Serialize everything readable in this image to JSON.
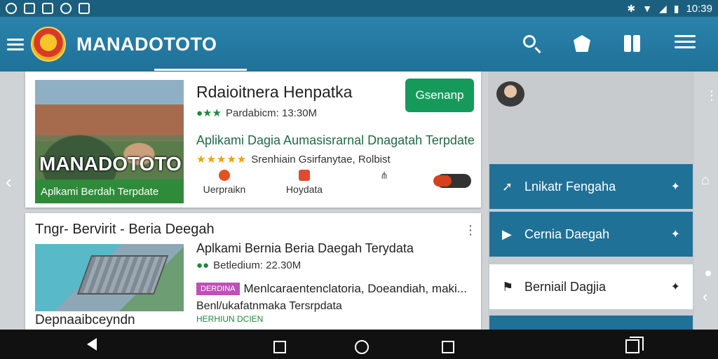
{
  "status_bar": {
    "time": "10:39"
  },
  "app_bar": {
    "title": "MANADOTOTO"
  },
  "card1": {
    "title": "Rdaioitnera Henpatka",
    "install_label": "Gsenanp",
    "meta": "Pardabicm: 13:30M",
    "subtitle": "Aplikami Dagia Aumasisrarnal Dnagatah Terpdate",
    "rating_text": "Srenhiain Gsirfanytae, Rolbist",
    "thumb_overlay_title": "MANADOTOTO",
    "thumb_overlay_caption": "Aplkami Berdah Terpdate",
    "actions": [
      {
        "label": "Uerpraikn"
      },
      {
        "label": "Hoydata"
      },
      {
        "label": ""
      }
    ]
  },
  "card2": {
    "title": "Tngr- Bervirit - Beria Deegah",
    "subtitle": "Aplkami Bernia Beria Daegah Terydata",
    "meta": "Betledium: 22.30M",
    "tag": "DERDINA",
    "tagline": "Menlcaraentenclatoria, Doeandiah, maki...",
    "desc": "Benl/ukafatnmaka Tersrpdata",
    "green_text": "HERHIUN DCIEN",
    "caption": "Depnaaibceyndn"
  },
  "side_panel": {
    "items": [
      {
        "label": "Lnikatr Fengaha"
      },
      {
        "label": "Cernia Daegah"
      },
      {
        "label": "Berniail Dagjia"
      }
    ]
  }
}
